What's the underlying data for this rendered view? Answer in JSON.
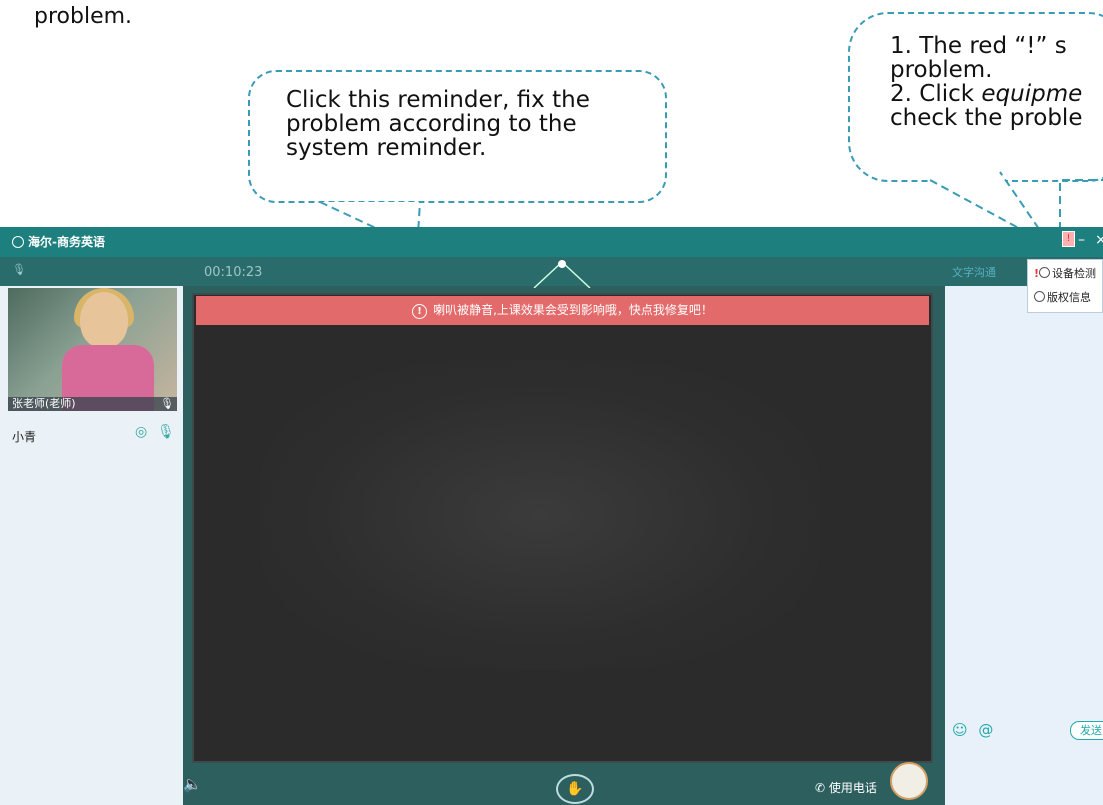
{
  "annotations": {
    "top_text": "problem.",
    "bubble1": "Click this reminder, fix the problem according to the system reminder.",
    "bubble2_lines": [
      "1. The red “!” s",
      "problem.",
      "2. Click ",
      "equipme",
      "check the proble"
    ]
  },
  "app": {
    "title": "海尔-商务英语",
    "timer": "00:10:23",
    "banner_text": "喇叭被静音,上课效果会受到影响哦，快点我修复吧！",
    "window_controls": [
      "!",
      "–",
      "×"
    ]
  },
  "left": {
    "teacher_label": "张老师(老师)",
    "student_name": "小青"
  },
  "right": {
    "chat_tab": "文字沟通",
    "menu": [
      {
        "label": "设备检测",
        "alert": "!"
      },
      {
        "label": "版权信息"
      }
    ],
    "send_label": "发送",
    "emoji": "☺",
    "at": "@"
  },
  "bottom": {
    "phone_label": "使用电话"
  },
  "colors": {
    "titlebar": "#1e7f7f",
    "banner": "#e36a6a",
    "board": "#2b2b2b",
    "bubble_border": "#3a9bb5"
  }
}
